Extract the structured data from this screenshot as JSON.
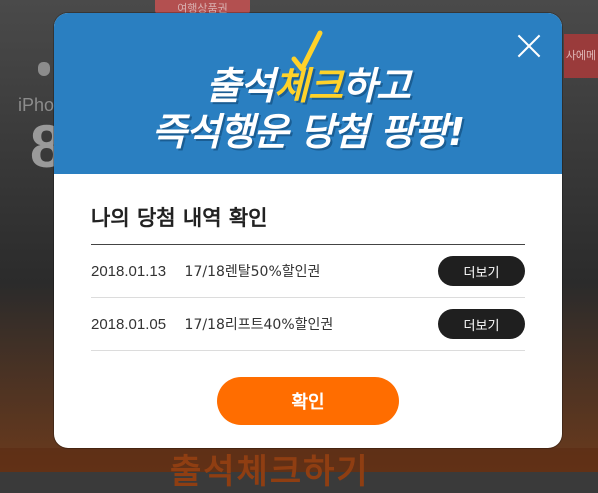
{
  "background": {
    "badge_top": "여행상품권",
    "badge_right": "사에메",
    "phone_text": "iPho",
    "phone_big": "8",
    "bottom_text": "출석체크하기"
  },
  "popup": {
    "title_line1_pre": "출석",
    "title_line1_hl": "체크",
    "title_line1_post": "하고",
    "title_line2": "즉석행운 당첨 팡팡!",
    "section_title": "나의 당첨 내역 확인",
    "rows": [
      {
        "date": "2018.01.13",
        "prize": "17/18렌탈50%할인권",
        "button": "더보기"
      },
      {
        "date": "2018.01.05",
        "prize": "17/18리프트40%할인권",
        "button": "더보기"
      }
    ],
    "confirm_label": "확인"
  },
  "colors": {
    "header_blue": "#2a7fc1",
    "highlight_yellow": "#ffd22a",
    "confirm_orange": "#ff6d00",
    "more_button_dark": "#1f1f1f"
  }
}
